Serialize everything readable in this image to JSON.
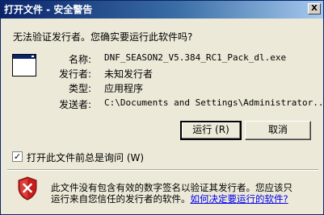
{
  "window": {
    "title": "打开文件 - 安全警告",
    "close_label": "X"
  },
  "question": "无法验证发行者。您确实要运行此软件吗?",
  "file_info": {
    "rows": [
      {
        "label": "名称:",
        "value": "DNF_SEASON2_V5.384_RC1_Pack_dl.exe"
      },
      {
        "label": "发行者:",
        "value": "未知发行者"
      },
      {
        "label": "类型:",
        "value": "应用程序"
      },
      {
        "label": "发送者:",
        "value": "C:\\Documents and Settings\\Administrator..."
      }
    ]
  },
  "buttons": {
    "run": "运行 (R)",
    "cancel": "取消"
  },
  "checkbox": {
    "checked": true,
    "mark": "✓",
    "label": "打开此文件前总是询问 (W)"
  },
  "warning": {
    "line1": "此文件没有包含有效的数字签名以验证其发行者。您应该只",
    "line2_prefix": "运行来自您信任的发行者的软件。",
    "link": "如何决定要运行的软件?"
  },
  "colors": {
    "titlebar": "#0a246a",
    "dialog_bg": "#ece9d8",
    "shield_red": "#c41e1e",
    "link": "#0000ee"
  },
  "icons": {
    "app": "application-window-icon",
    "warning": "security-shield-icon",
    "close": "close-icon"
  }
}
